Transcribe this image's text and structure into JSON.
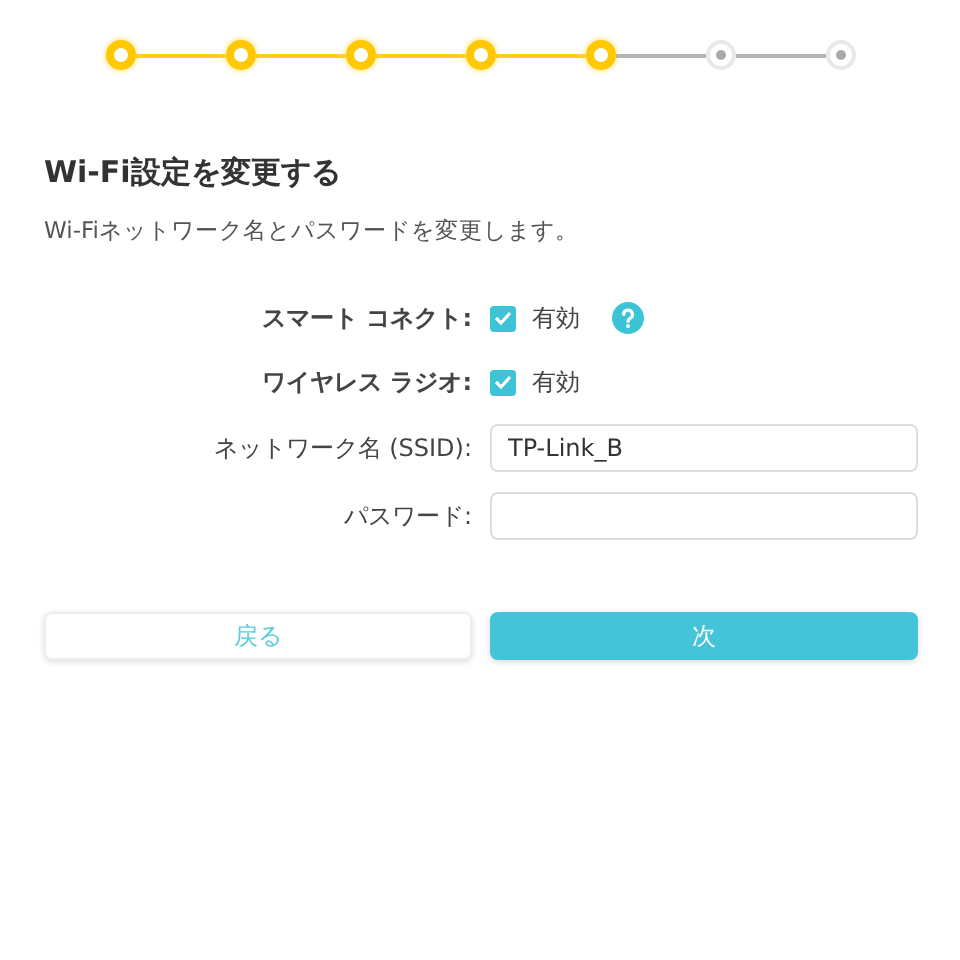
{
  "steps": [
    {
      "done": true
    },
    {
      "done": true
    },
    {
      "done": true
    },
    {
      "done": true
    },
    {
      "done": true
    },
    {
      "done": false
    },
    {
      "done": false
    }
  ],
  "title": "Wi-Fi設定を変更する",
  "subtitle": "Wi-Fiネットワーク名とパスワードを変更します。",
  "rows": [
    {
      "kind": "checkbox",
      "label": "スマート コネクト:",
      "bold": true,
      "checked": true,
      "option": "有効",
      "help": true
    },
    {
      "kind": "checkbox",
      "label": "ワイヤレス ラジオ:",
      "bold": true,
      "checked": true,
      "option": "有効",
      "help": false
    },
    {
      "kind": "text",
      "label": "ネットワーク名 (SSID):",
      "bold": false,
      "value": "TP-Link_B"
    },
    {
      "kind": "text",
      "label": "パスワード:",
      "bold": false,
      "value": ""
    }
  ],
  "buttons": [
    {
      "label": "戻る",
      "kind": "secondary"
    },
    {
      "label": "次",
      "kind": "primary"
    }
  ]
}
